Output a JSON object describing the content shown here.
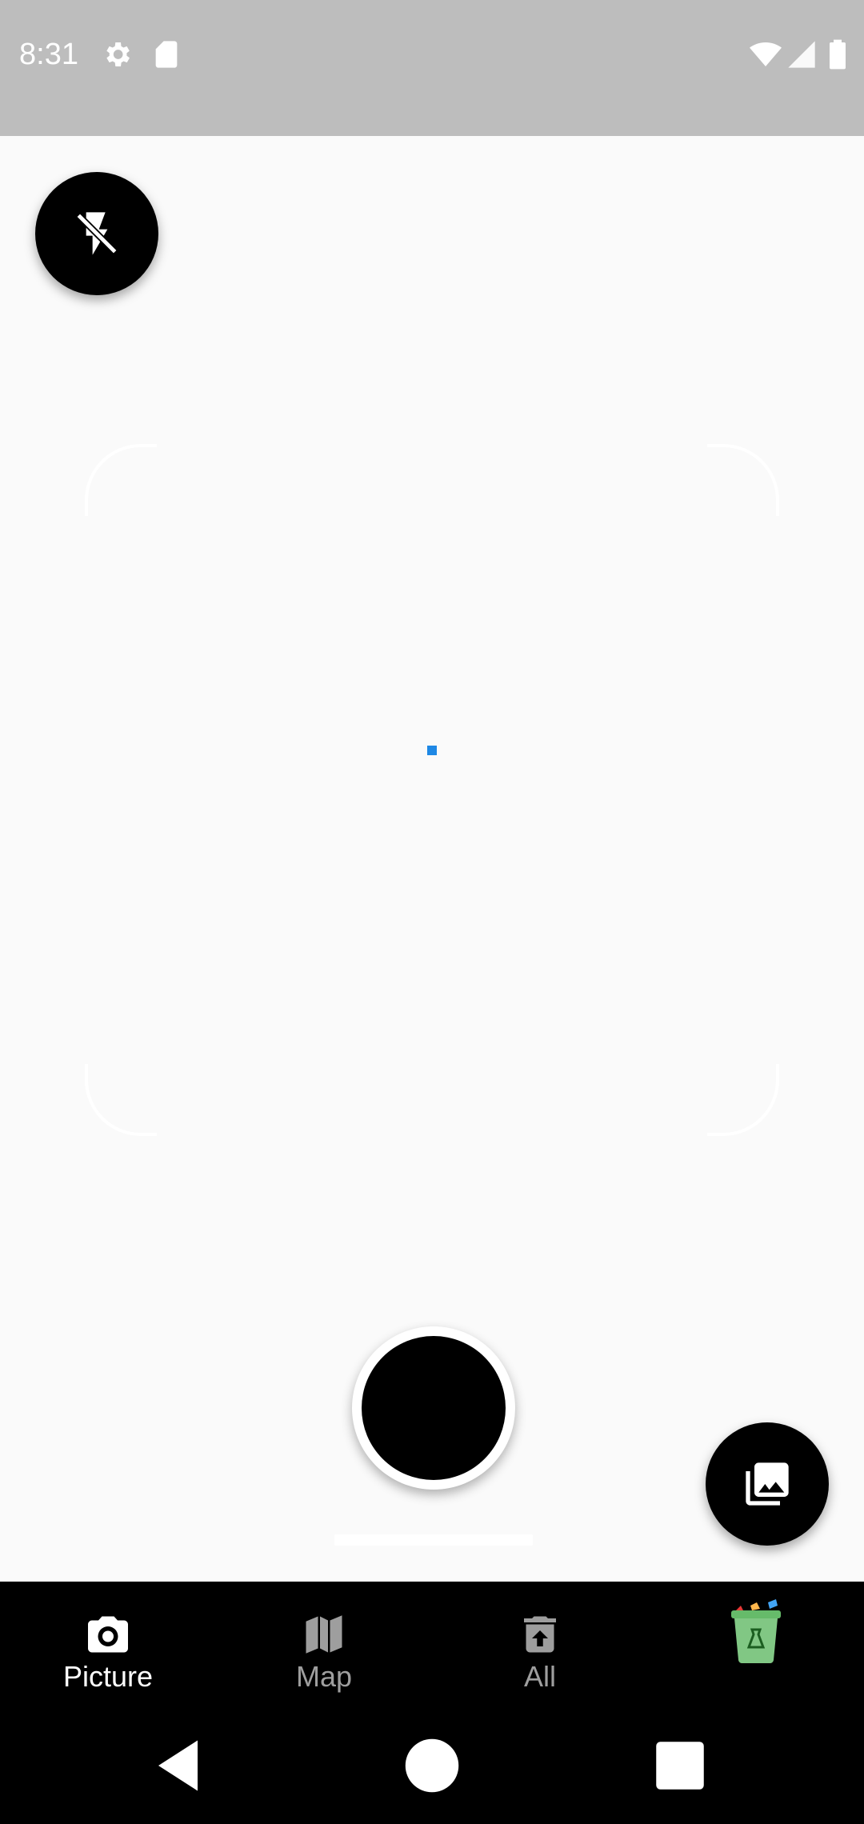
{
  "status_bar": {
    "time": "8:31",
    "icons": [
      "settings-icon",
      "sd-card-icon",
      "wifi-icon",
      "signal-icon",
      "battery-icon"
    ]
  },
  "camera": {
    "flash_icon": "flash-off-icon",
    "gallery_icon": "photo-library-icon",
    "focus_color": "#1e88e5"
  },
  "bottom_nav": {
    "items": [
      {
        "label": "Picture",
        "icon": "camera-icon",
        "active": true
      },
      {
        "label": "Map",
        "icon": "map-icon",
        "active": false
      },
      {
        "label": "All",
        "icon": "trash-upload-icon",
        "active": false
      },
      {
        "label": "",
        "icon": "recycle-bin-icon",
        "active": false
      }
    ]
  },
  "system_nav": {
    "buttons": [
      "back-icon",
      "home-icon",
      "recents-icon"
    ]
  },
  "colors": {
    "status_bar": "#bdbdbd",
    "background": "#fafafa",
    "nav_background": "#000000",
    "nav_active": "#ffffff",
    "nav_inactive": "#9e9e9e",
    "bin_green": "#7ccd6a"
  }
}
